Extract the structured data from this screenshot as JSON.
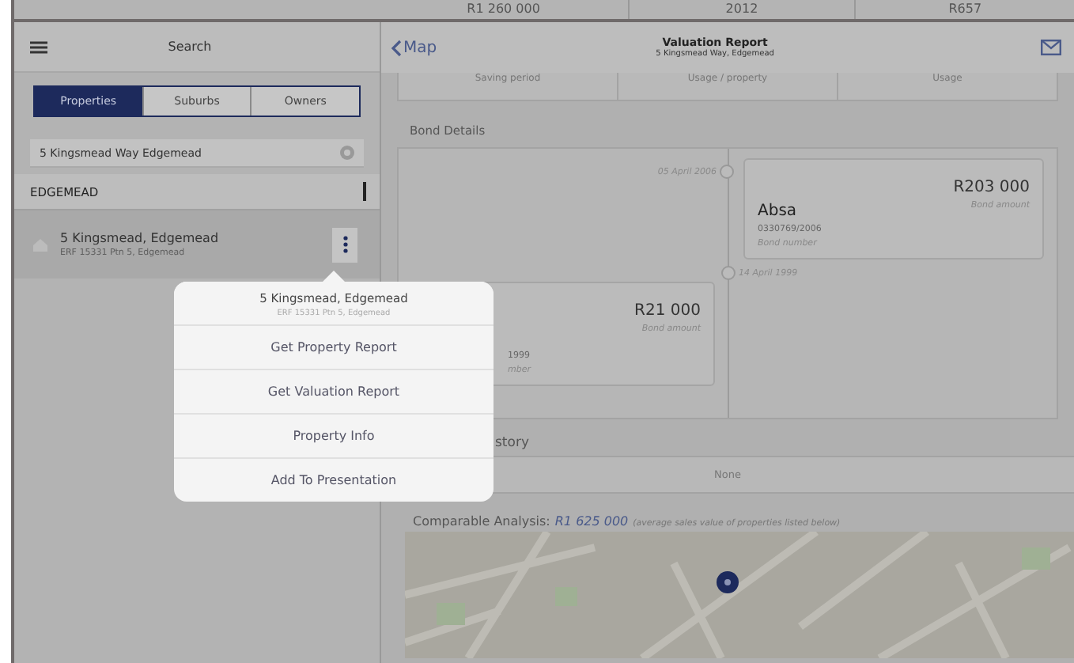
{
  "previous_row": [
    "R1 260 000",
    "2012",
    "R657"
  ],
  "sidebar": {
    "title": "Search",
    "segments": [
      {
        "label": "Properties",
        "selected": true
      },
      {
        "label": "Suburbs",
        "selected": false
      },
      {
        "label": "Owners",
        "selected": false
      }
    ],
    "search": {
      "value": "5 Kingsmead Way Edgemead"
    },
    "group": "EDGEMEAD",
    "results": [
      {
        "title": "5 Kingsmead, Edgemead",
        "subtitle": "ERF 15331 Ptn 5, Edgemead",
        "selected": true
      }
    ]
  },
  "popup": {
    "title": "5 Kingsmead, Edgemead",
    "subtitle": "ERF 15331 Ptn 5, Edgemead",
    "items": [
      "Get Property Report",
      "Get Valuation Report",
      "Property Info",
      "Add To Presentation"
    ]
  },
  "report": {
    "back": "Map",
    "title": "Valuation Report",
    "subtitle": "5 Kingsmead Way, Edgemead",
    "cut_row": [
      "Saving period",
      "Usage / property",
      "Usage"
    ],
    "bond_section": "Bond Details",
    "bonds": [
      {
        "kind": "upper",
        "date": "05 April 2006",
        "bank": "Absa",
        "number": "0330769/2006",
        "number_label": "Bond number",
        "amount": "R203 000",
        "amount_label": "Bond amount"
      },
      {
        "kind": "lower",
        "date": "14 April 1999",
        "number": "1999",
        "number_label": "mber",
        "amount": "R21 000",
        "amount_label": "Bond amount"
      }
    ],
    "history_section": "story",
    "history_value": "None",
    "comparable": {
      "label": "Comparable Analysis:",
      "value": "R1 625 000",
      "note": "(average sales value of properties listed below)"
    }
  }
}
